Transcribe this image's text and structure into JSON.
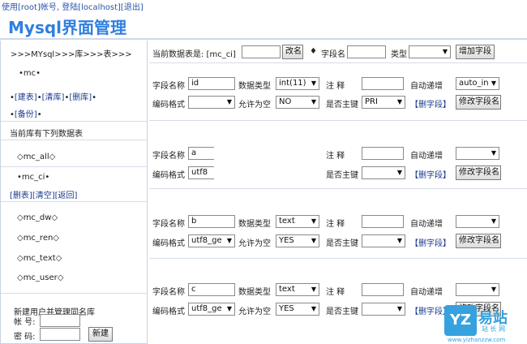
{
  "top": {
    "pre": "使用[",
    "user": "root",
    "mid": "]帐号, 登陆[",
    "host": "localhost",
    "post": "][",
    "logout": "退出",
    "end": "]"
  },
  "title": "Mysql界面管理",
  "sidebar": {
    "breadcrumb": ">>>MYsql>>>库>>>表>>>",
    "db_name": "•mc•",
    "db_actions": [
      "[建表]",
      "[清库]",
      "[删库]"
    ],
    "db_backup": "[备份]",
    "tables_heading": "当前库有下列数据表",
    "tables": [
      {
        "label": "◇mc_all◇"
      },
      {
        "label": "•mc_ci•"
      },
      {
        "label": "◇mc_dw◇"
      },
      {
        "label": "◇mc_ren◇"
      },
      {
        "label": "◇mc_text◇"
      },
      {
        "label": "◇mc_user◇"
      }
    ],
    "table_actions": [
      "[删表]",
      "[清空]",
      "[返回]"
    ],
    "new_user_heading": "新建用户并管理同名库",
    "account_label": "帐 号:",
    "password_label": "密 码:",
    "create_button": "新建"
  },
  "header": {
    "current_table_label": "当前数据表是: [mc_ci]",
    "rename_button": "改名",
    "diamond": "♦",
    "field_name_label": "字段名",
    "type_label": "类型",
    "add_field_button": "增加字段"
  },
  "labels": {
    "field_name": "字段名称",
    "data_type": "数据类型",
    "note": "注  释",
    "auto_inc": "自动递增",
    "encoding": "编码格式",
    "allow_null": "允许为空",
    "primary_key": "是否主键",
    "delete_field": "【删字段】",
    "modify_field": "修改字段名"
  },
  "fields": [
    {
      "name": "id",
      "type": "int(11)",
      "encoding": "",
      "allow_null": "NO",
      "primary": "PRI",
      "auto": "auto_in"
    },
    {
      "name": "a",
      "type": "",
      "encoding": "utf8",
      "allow_null": "",
      "primary": "",
      "auto": ""
    },
    {
      "name": "b",
      "type": "text",
      "encoding": "utf8_ge",
      "allow_null": "YES",
      "primary": "",
      "auto": ""
    },
    {
      "name": "c",
      "type": "text",
      "encoding": "utf8_ge",
      "allow_null": "YES",
      "primary": "",
      "auto": ""
    }
  ],
  "watermark": {
    "logo": "YZ",
    "name": "易站",
    "sub": "站 长 网",
    "url": "www.yizhanzzw.com"
  }
}
